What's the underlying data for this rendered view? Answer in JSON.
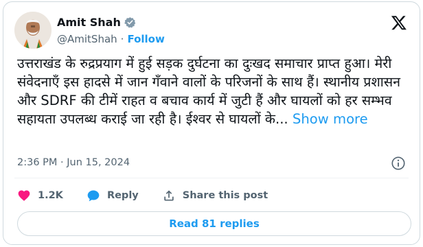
{
  "author": {
    "name": "Amit Shah",
    "handle": "@AmitShah",
    "separator": "·",
    "follow_label": "Follow"
  },
  "tweet": {
    "text": "उत्तराखंड के रुद्रप्रयाग में हुई सड़क दुर्घटना का दुःखद समाचार प्राप्त हुआ। मेरी संवेदनाएँ इस हादसे में जान गँवाने वालों के परिजनों के साथ हैं। स्थानीय प्रशासन और SDRF की टीमें राहत व बचाव कार्य में जुटी हैं और घायलों को हर सम्भव सहायता उपलब्ध कराई जा रही है। ईश्वर से घायलों के...",
    "show_more": "Show more",
    "timestamp": "2:36 PM · Jun 15, 2024"
  },
  "actions": {
    "likes": "1.2K",
    "reply_label": "Reply",
    "share_label": "Share this post"
  },
  "read_replies": "Read 81 replies",
  "colors": {
    "accent": "#1d9bf0",
    "like": "#f91880",
    "muted": "#536471"
  },
  "icons": {
    "verified": "verified-badge-icon",
    "platform": "x-logo-icon",
    "info": "info-icon",
    "like": "heart-icon",
    "reply": "speech-bubble-icon",
    "share": "upload-share-icon"
  }
}
